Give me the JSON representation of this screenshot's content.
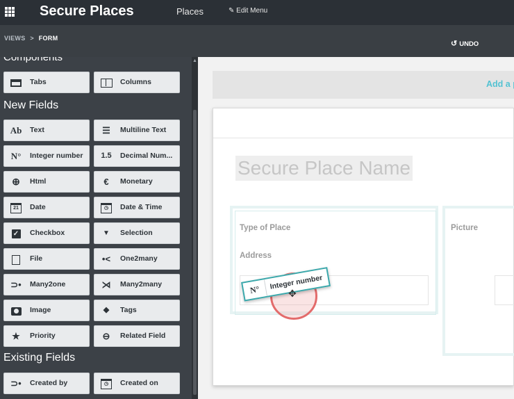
{
  "navbar": {
    "app_title": "Secure Places",
    "menu_places": "Places",
    "edit_menu": "Edit Menu",
    "edit_icon": "pencil-icon",
    "apps_icon": "grid-apps-icon"
  },
  "breadcrumb": {
    "views": "VIEWS",
    "separator": ">",
    "current": "FORM"
  },
  "toolbar": {
    "undo_label": "UNDO",
    "undo_icon": "undo-icon"
  },
  "sidebar": {
    "components_title": "Components",
    "components": [
      {
        "label": "Tabs",
        "icon": "tabs-icon"
      },
      {
        "label": "Columns",
        "icon": "columns-icon"
      }
    ],
    "new_fields_title": "New Fields",
    "new_fields": [
      {
        "label": "Text",
        "icon": "text-icon",
        "glyph": "Ab"
      },
      {
        "label": "Multiline Text",
        "icon": "multiline-text-icon",
        "glyph": "☰"
      },
      {
        "label": "Integer number",
        "icon": "integer-icon",
        "glyph": "N°"
      },
      {
        "label": "Decimal Num...",
        "icon": "decimal-icon",
        "glyph": "1.5"
      },
      {
        "label": "Html",
        "icon": "globe-icon",
        "glyph": "🌐"
      },
      {
        "label": "Monetary",
        "icon": "euro-icon",
        "glyph": "€"
      },
      {
        "label": "Date",
        "icon": "calendar-icon",
        "glyph": "21"
      },
      {
        "label": "Date & Time",
        "icon": "clock-calendar-icon",
        "glyph": "◷"
      },
      {
        "label": "Checkbox",
        "icon": "checkbox-icon",
        "glyph": "✓"
      },
      {
        "label": "Selection",
        "icon": "caret-down-icon",
        "glyph": "▼"
      },
      {
        "label": "File",
        "icon": "file-icon",
        "glyph": ""
      },
      {
        "label": "One2many",
        "icon": "one2many-icon",
        "glyph": "•<"
      },
      {
        "label": "Many2one",
        "icon": "many2one-icon",
        "glyph": "⊃•"
      },
      {
        "label": "Many2many",
        "icon": "many2many-icon",
        "glyph": "⋊"
      },
      {
        "label": "Image",
        "icon": "camera-icon",
        "glyph": ""
      },
      {
        "label": "Tags",
        "icon": "tag-icon",
        "glyph": "◆"
      },
      {
        "label": "Priority",
        "icon": "star-icon",
        "glyph": "★"
      },
      {
        "label": "Related Field",
        "icon": "link-icon",
        "glyph": "⊖"
      }
    ],
    "existing_fields_title": "Existing Fields",
    "existing_fields": [
      {
        "label": "Created by",
        "icon": "many2one-icon",
        "glyph": "⊃•"
      },
      {
        "label": "Created on",
        "icon": "clock-calendar-icon",
        "glyph": "◷"
      }
    ]
  },
  "form": {
    "add_link": "Add a p",
    "record_name_placeholder": "Secure Place Name",
    "type_of_place_label": "Type of Place",
    "address_label": "Address",
    "picture_label": "Picture"
  },
  "drag": {
    "chip_label": "Integer number",
    "chip_glyph": "N°",
    "cursor_icon": "move-cursor-icon"
  },
  "colors": {
    "navbar": "#2b3036",
    "sidebar": "#3c4147",
    "accent": "#53c2d2",
    "drop_zone": "#e6f3f3",
    "click_ring": "#e36b6b"
  }
}
